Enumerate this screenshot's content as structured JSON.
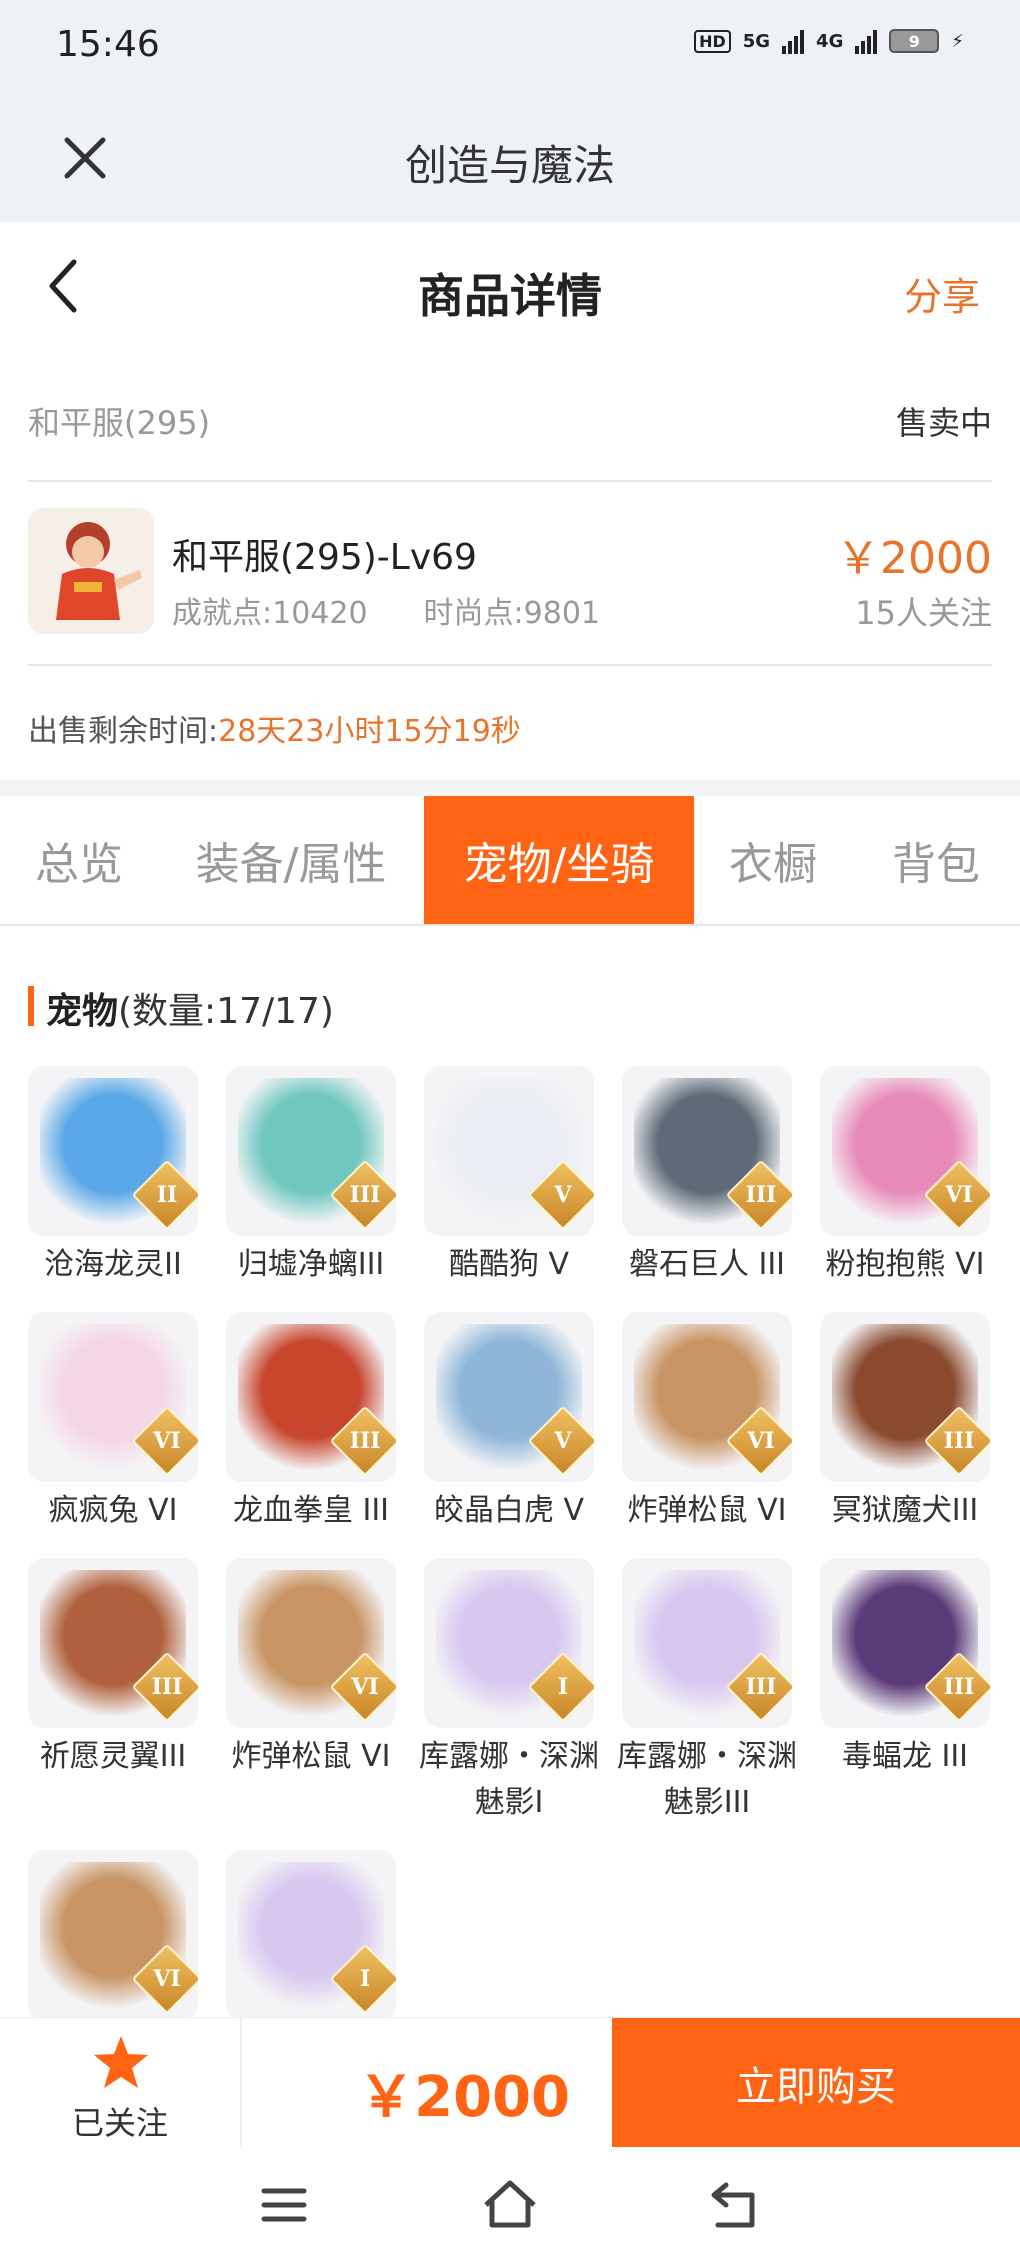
{
  "status_bar": {
    "time": "15:46",
    "network_1": "5G",
    "network_2": "4G",
    "battery": "9"
  },
  "app_bar": {
    "title": "创造与魔法",
    "close_icon": "close-icon"
  },
  "header": {
    "title": "商品详情",
    "share_label": "分享",
    "back_icon": "chevron-left-icon"
  },
  "account": {
    "name": "和平服(295)",
    "status": "售卖中"
  },
  "item": {
    "title": "和平服(295)-Lv69",
    "achievement": "成就点:10420",
    "fashion": "时尚点:9801",
    "price": "￥2000",
    "followers": "15人关注"
  },
  "sale_time": {
    "label": "出售剩余时间:",
    "value": "28天23小时15分19秒"
  },
  "tabs": [
    {
      "label": "总览",
      "active": false
    },
    {
      "label": "装备/属性",
      "active": false
    },
    {
      "label": "宠物/坐骑",
      "active": true
    },
    {
      "label": "衣橱",
      "active": false
    },
    {
      "label": "背包",
      "active": false
    }
  ],
  "section": {
    "title": "宠物",
    "count": "(数量:17/17)"
  },
  "pets": [
    {
      "name": "沧海龙灵II",
      "grade": "II",
      "color": "#5aa8e8"
    },
    {
      "name": "归墟净螭III",
      "grade": "III",
      "color": "#6fc7c0"
    },
    {
      "name": "酷酷狗 V",
      "grade": "V",
      "color": "#e9ecf2"
    },
    {
      "name": "磐石巨人 III",
      "grade": "III",
      "color": "#5d6b78"
    },
    {
      "name": "粉抱抱熊 VI",
      "grade": "VI",
      "color": "#e88ab8"
    },
    {
      "name": "疯疯兔 VI",
      "grade": "VI",
      "color": "#f4d6e6"
    },
    {
      "name": "龙血拳皇 III",
      "grade": "III",
      "color": "#c8462e"
    },
    {
      "name": "皎晶白虎 V",
      "grade": "V",
      "color": "#8fb6d8"
    },
    {
      "name": "炸弹松鼠 VI",
      "grade": "VI",
      "color": "#c89464"
    },
    {
      "name": "冥狱魔犬III",
      "grade": "III",
      "color": "#8a4a2e"
    },
    {
      "name": "祈愿灵翼III",
      "grade": "III",
      "color": "#b0603c"
    },
    {
      "name": "炸弹松鼠 VI",
      "grade": "VI",
      "color": "#c89464"
    },
    {
      "name": "库露娜・深渊魅影I",
      "grade": "I",
      "color": "#d8c8f0"
    },
    {
      "name": "库露娜・深渊魅影III",
      "grade": "III",
      "color": "#d8c8f0"
    },
    {
      "name": "毒蝠龙 III",
      "grade": "III",
      "color": "#5a3a78"
    },
    {
      "name": "",
      "grade": "VI",
      "color": "#c89464"
    },
    {
      "name": "",
      "grade": "I",
      "color": "#d8c8f0"
    }
  ],
  "bottom": {
    "follow_label": "已关注",
    "price": "￥2000",
    "buy_label": "立即购买"
  }
}
